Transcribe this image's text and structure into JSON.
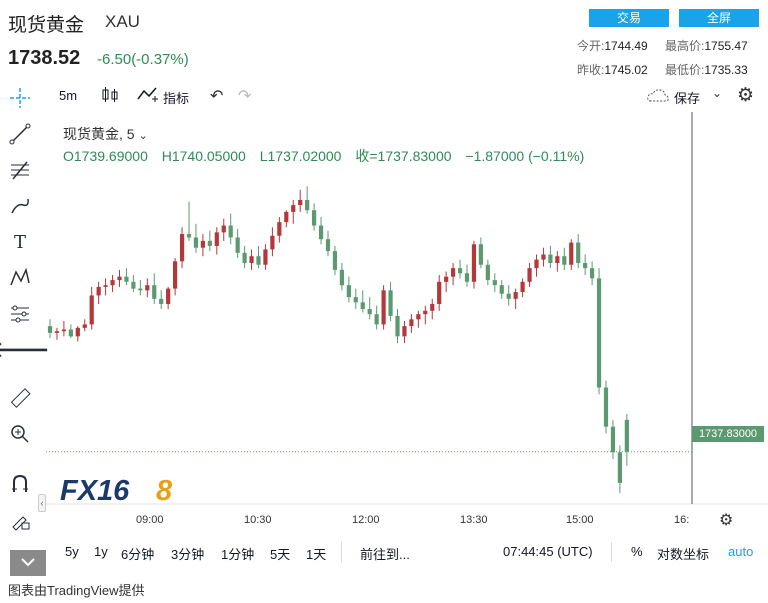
{
  "header": {
    "title": "现货黄金",
    "symbol": "XAU",
    "price": "1738.52",
    "change": "-6.50(-0.37%)",
    "trade_button": "交易",
    "fullscreen_button": "全屏",
    "stats": {
      "open_label": "今开:",
      "open_value": "1744.49",
      "high_label": "最高价:",
      "high_value": "1755.47",
      "prev_close_label": "昨收:",
      "prev_close_value": "1745.02",
      "low_label": "最低价:",
      "low_value": "1735.33"
    }
  },
  "chart_toolbar": {
    "interval": "5m",
    "indicators": "指标",
    "save": "保存"
  },
  "legend": {
    "name": "现货黄金, 5",
    "open": "O1739.69000",
    "high": "H1740.05000",
    "low": "L1737.02000",
    "close": "收=1737.83000",
    "change": "−1.87000 (−0.11%)"
  },
  "price_tag": "1737.83000",
  "watermark": "FX168",
  "bottom_bar": {
    "ranges": [
      "5y",
      "1y",
      "6分钟",
      "3分钟",
      "1分钟",
      "5天",
      "1天"
    ],
    "goto": "前往到...",
    "time": "07:44:45 (UTC)",
    "percent": "%",
    "log": "对数坐标",
    "auto": "auto"
  },
  "footer": "图表由TradingView提供",
  "colors": {
    "up": "#b5373a",
    "down": "#5b9a71",
    "accent": "#1aa3e8"
  },
  "chart_data": {
    "type": "candlestick",
    "x_ticks": [
      "09:00",
      "10:30",
      "12:00",
      "13:30",
      "15:00",
      "16:"
    ],
    "ylim": [
      1735,
      1756
    ],
    "candles": [
      {
        "o": 1745.2,
        "h": 1745.6,
        "l": 1744.5,
        "c": 1744.8
      },
      {
        "o": 1744.8,
        "h": 1745.1,
        "l": 1744.4,
        "c": 1744.9
      },
      {
        "o": 1744.9,
        "h": 1745.5,
        "l": 1744.6,
        "c": 1745.0
      },
      {
        "o": 1745.0,
        "h": 1745.3,
        "l": 1744.5,
        "c": 1744.6
      },
      {
        "o": 1744.6,
        "h": 1745.2,
        "l": 1744.3,
        "c": 1745.1
      },
      {
        "o": 1745.1,
        "h": 1745.6,
        "l": 1744.9,
        "c": 1745.3
      },
      {
        "o": 1745.3,
        "h": 1747.5,
        "l": 1745.0,
        "c": 1747.0
      },
      {
        "o": 1747.0,
        "h": 1747.8,
        "l": 1746.5,
        "c": 1747.5
      },
      {
        "o": 1747.5,
        "h": 1748.0,
        "l": 1747.0,
        "c": 1747.6
      },
      {
        "o": 1747.6,
        "h": 1748.2,
        "l": 1747.2,
        "c": 1747.9
      },
      {
        "o": 1747.9,
        "h": 1748.5,
        "l": 1747.5,
        "c": 1748.1
      },
      {
        "o": 1748.1,
        "h": 1748.6,
        "l": 1747.6,
        "c": 1747.8
      },
      {
        "o": 1747.8,
        "h": 1748.2,
        "l": 1747.2,
        "c": 1747.4
      },
      {
        "o": 1747.4,
        "h": 1747.9,
        "l": 1747.0,
        "c": 1747.3
      },
      {
        "o": 1747.3,
        "h": 1748.0,
        "l": 1746.9,
        "c": 1747.6
      },
      {
        "o": 1747.6,
        "h": 1748.3,
        "l": 1746.5,
        "c": 1746.8
      },
      {
        "o": 1746.8,
        "h": 1747.3,
        "l": 1746.2,
        "c": 1746.5
      },
      {
        "o": 1746.5,
        "h": 1747.5,
        "l": 1746.2,
        "c": 1747.4
      },
      {
        "o": 1747.4,
        "h": 1749.2,
        "l": 1747.0,
        "c": 1749.0
      },
      {
        "o": 1749.0,
        "h": 1751.0,
        "l": 1748.6,
        "c": 1750.6
      },
      {
        "o": 1750.6,
        "h": 1752.5,
        "l": 1750.2,
        "c": 1750.4
      },
      {
        "o": 1750.4,
        "h": 1751.2,
        "l": 1749.5,
        "c": 1749.8
      },
      {
        "o": 1749.8,
        "h": 1750.6,
        "l": 1749.3,
        "c": 1750.2
      },
      {
        "o": 1750.2,
        "h": 1750.8,
        "l": 1749.6,
        "c": 1749.9
      },
      {
        "o": 1749.9,
        "h": 1751.0,
        "l": 1749.4,
        "c": 1750.7
      },
      {
        "o": 1750.7,
        "h": 1751.5,
        "l": 1750.2,
        "c": 1751.1
      },
      {
        "o": 1751.1,
        "h": 1751.8,
        "l": 1750.0,
        "c": 1750.4
      },
      {
        "o": 1750.4,
        "h": 1750.9,
        "l": 1749.2,
        "c": 1749.5
      },
      {
        "o": 1749.5,
        "h": 1749.9,
        "l": 1748.6,
        "c": 1748.9
      },
      {
        "o": 1748.9,
        "h": 1749.7,
        "l": 1748.5,
        "c": 1749.3
      },
      {
        "o": 1749.3,
        "h": 1749.9,
        "l": 1748.6,
        "c": 1748.8
      },
      {
        "o": 1748.8,
        "h": 1750.0,
        "l": 1748.5,
        "c": 1749.7
      },
      {
        "o": 1749.7,
        "h": 1751.0,
        "l": 1749.3,
        "c": 1750.5
      },
      {
        "o": 1750.5,
        "h": 1751.6,
        "l": 1750.1,
        "c": 1751.3
      },
      {
        "o": 1751.3,
        "h": 1752.0,
        "l": 1751.0,
        "c": 1751.9
      },
      {
        "o": 1751.9,
        "h": 1752.6,
        "l": 1751.2,
        "c": 1752.3
      },
      {
        "o": 1752.3,
        "h": 1753.2,
        "l": 1751.9,
        "c": 1752.6
      },
      {
        "o": 1752.6,
        "h": 1753.4,
        "l": 1751.8,
        "c": 1752.0
      },
      {
        "o": 1752.0,
        "h": 1752.4,
        "l": 1750.8,
        "c": 1751.1
      },
      {
        "o": 1751.1,
        "h": 1751.6,
        "l": 1750.0,
        "c": 1750.3
      },
      {
        "o": 1750.3,
        "h": 1750.8,
        "l": 1749.3,
        "c": 1749.6
      },
      {
        "o": 1749.6,
        "h": 1749.9,
        "l": 1748.2,
        "c": 1748.5
      },
      {
        "o": 1748.5,
        "h": 1748.9,
        "l": 1747.3,
        "c": 1747.6
      },
      {
        "o": 1747.6,
        "h": 1748.1,
        "l": 1746.6,
        "c": 1746.9
      },
      {
        "o": 1746.9,
        "h": 1747.4,
        "l": 1746.2,
        "c": 1746.6
      },
      {
        "o": 1746.6,
        "h": 1747.3,
        "l": 1746.0,
        "c": 1746.2
      },
      {
        "o": 1746.2,
        "h": 1746.9,
        "l": 1745.6,
        "c": 1745.9
      },
      {
        "o": 1745.9,
        "h": 1746.4,
        "l": 1745.0,
        "c": 1745.3
      },
      {
        "o": 1745.3,
        "h": 1747.6,
        "l": 1745.0,
        "c": 1747.3
      },
      {
        "o": 1747.3,
        "h": 1747.8,
        "l": 1745.5,
        "c": 1745.8
      },
      {
        "o": 1745.8,
        "h": 1746.2,
        "l": 1744.2,
        "c": 1744.6
      },
      {
        "o": 1744.6,
        "h": 1745.5,
        "l": 1744.2,
        "c": 1745.2
      },
      {
        "o": 1745.2,
        "h": 1745.9,
        "l": 1744.8,
        "c": 1745.6
      },
      {
        "o": 1745.6,
        "h": 1746.1,
        "l": 1745.1,
        "c": 1745.9
      },
      {
        "o": 1745.9,
        "h": 1746.4,
        "l": 1745.3,
        "c": 1746.1
      },
      {
        "o": 1746.1,
        "h": 1746.8,
        "l": 1745.6,
        "c": 1746.5
      },
      {
        "o": 1746.5,
        "h": 1748.2,
        "l": 1746.1,
        "c": 1747.8
      },
      {
        "o": 1747.8,
        "h": 1748.4,
        "l": 1747.2,
        "c": 1748.1
      },
      {
        "o": 1748.1,
        "h": 1748.9,
        "l": 1747.6,
        "c": 1748.6
      },
      {
        "o": 1748.6,
        "h": 1749.1,
        "l": 1748.0,
        "c": 1748.3
      },
      {
        "o": 1748.3,
        "h": 1748.8,
        "l": 1747.5,
        "c": 1747.8
      },
      {
        "o": 1747.8,
        "h": 1750.2,
        "l": 1747.4,
        "c": 1750.0
      },
      {
        "o": 1750.0,
        "h": 1750.4,
        "l": 1748.6,
        "c": 1748.8
      },
      {
        "o": 1748.8,
        "h": 1749.1,
        "l": 1747.6,
        "c": 1747.9
      },
      {
        "o": 1747.9,
        "h": 1748.3,
        "l": 1747.2,
        "c": 1747.6
      },
      {
        "o": 1747.6,
        "h": 1747.9,
        "l": 1746.8,
        "c": 1747.1
      },
      {
        "o": 1747.1,
        "h": 1747.6,
        "l": 1746.4,
        "c": 1746.8
      },
      {
        "o": 1746.8,
        "h": 1747.4,
        "l": 1746.2,
        "c": 1747.2
      },
      {
        "o": 1747.2,
        "h": 1748.0,
        "l": 1746.9,
        "c": 1747.8
      },
      {
        "o": 1747.8,
        "h": 1748.9,
        "l": 1747.5,
        "c": 1748.6
      },
      {
        "o": 1748.6,
        "h": 1749.4,
        "l": 1748.1,
        "c": 1749.1
      },
      {
        "o": 1749.1,
        "h": 1749.8,
        "l": 1748.7,
        "c": 1749.4
      },
      {
        "o": 1749.4,
        "h": 1749.9,
        "l": 1748.6,
        "c": 1748.9
      },
      {
        "o": 1748.9,
        "h": 1749.6,
        "l": 1748.4,
        "c": 1749.3
      },
      {
        "o": 1749.3,
        "h": 1749.8,
        "l": 1748.5,
        "c": 1748.8
      },
      {
        "o": 1748.8,
        "h": 1750.3,
        "l": 1748.5,
        "c": 1750.1
      },
      {
        "o": 1750.1,
        "h": 1750.6,
        "l": 1748.6,
        "c": 1748.9
      },
      {
        "o": 1748.9,
        "h": 1749.4,
        "l": 1748.2,
        "c": 1748.6
      },
      {
        "o": 1748.6,
        "h": 1749.0,
        "l": 1747.6,
        "c": 1748.0
      },
      {
        "o": 1748.0,
        "h": 1748.6,
        "l": 1741.2,
        "c": 1741.6
      },
      {
        "o": 1741.6,
        "h": 1742.0,
        "l": 1738.9,
        "c": 1739.3
      },
      {
        "o": 1739.3,
        "h": 1739.7,
        "l": 1737.4,
        "c": 1737.8
      },
      {
        "o": 1737.8,
        "h": 1738.2,
        "l": 1735.4,
        "c": 1736.0
      },
      {
        "o": 1739.7,
        "h": 1740.05,
        "l": 1737.02,
        "c": 1737.83
      }
    ]
  }
}
